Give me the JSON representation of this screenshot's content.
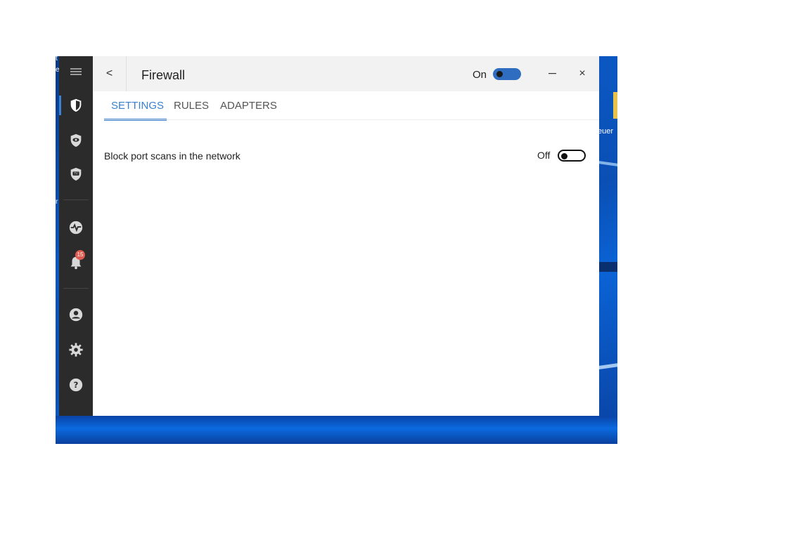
{
  "desktop": {
    "folder_label": "euer",
    "edge_text": [
      "t",
      "e",
      "r"
    ]
  },
  "sidebar": {
    "items": [
      {
        "icon": "menu-icon"
      },
      {
        "icon": "shield-check-icon",
        "active": true
      },
      {
        "icon": "shield-eye-icon"
      },
      {
        "icon": "shield-tv-icon"
      },
      {
        "icon": "activity-icon"
      },
      {
        "icon": "bell-icon",
        "badge": "15"
      },
      {
        "icon": "user-icon"
      },
      {
        "icon": "gear-icon"
      },
      {
        "icon": "help-icon"
      }
    ]
  },
  "window": {
    "title": "Firewall",
    "protection_label": "On",
    "protection_enabled": true,
    "back_glyph": "<",
    "close_glyph": "×"
  },
  "tabs": [
    {
      "label": "SETTINGS",
      "active": true
    },
    {
      "label": "RULES",
      "active": false
    },
    {
      "label": "ADAPTERS",
      "active": false
    }
  ],
  "settings": {
    "block_port_scans": {
      "label": "Block port scans in the network",
      "state_label": "Off",
      "enabled": false
    }
  },
  "colors": {
    "accent": "#3a7fd0",
    "toggle_on": "#2f6dc0",
    "sidebar_bg": "#2b2b2b",
    "badge": "#e05a4f"
  }
}
